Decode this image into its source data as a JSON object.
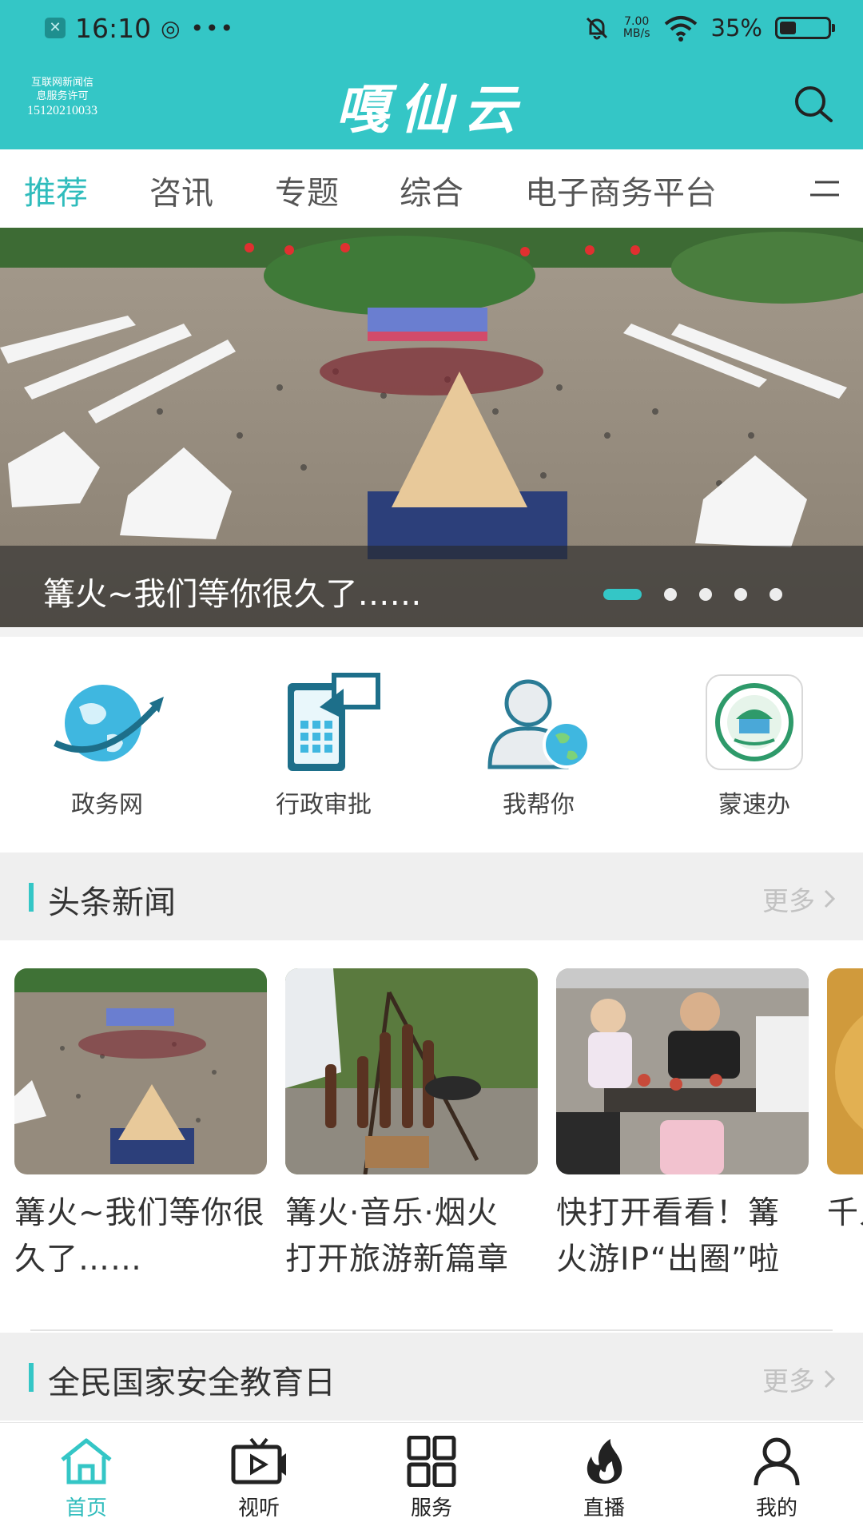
{
  "status_bar": {
    "time": "16:10",
    "misc": "◎ •••",
    "net_speed_value": "7.00",
    "net_speed_unit": "MB/s",
    "battery_text": "35%",
    "battery_level": 0.35
  },
  "header": {
    "license_line1": "互联网新闻信",
    "license_line2": "息服务许可",
    "license_number": "15120210033",
    "brand": "嘎仙云"
  },
  "tabs": [
    {
      "label": "推荐",
      "active": true
    },
    {
      "label": "咨讯",
      "active": false
    },
    {
      "label": "专题",
      "active": false
    },
    {
      "label": "综合",
      "active": false
    },
    {
      "label": "电子商务平台",
      "active": false
    }
  ],
  "hero": {
    "caption": "篝火~我们等你很久了……",
    "slide_count": 5,
    "active_slide": 1
  },
  "services": [
    {
      "label": "政务网",
      "icon": "globe-arrow-icon"
    },
    {
      "label": "行政审批",
      "icon": "approval-phone-icon"
    },
    {
      "label": "我帮你",
      "icon": "user-globe-icon"
    },
    {
      "label": "蒙速办",
      "icon": "mengsuban-logo-icon"
    }
  ],
  "sections": {
    "headline": {
      "title": "头条新闻",
      "more": "更多"
    },
    "security": {
      "title": "全民国家安全教育日",
      "more": "更多"
    }
  },
  "news": [
    {
      "title": "篝火~我们等你很久了……"
    },
    {
      "title": "篝火·音乐·烟火  打开旅游新篇章"
    },
    {
      "title": "快打开看看！篝火游IP“出圈”啦"
    },
    {
      "title": "千人篝火等你来"
    }
  ],
  "bottom_nav": [
    {
      "label": "首页",
      "icon": "home-icon",
      "active": true
    },
    {
      "label": "视听",
      "icon": "tv-play-icon",
      "active": false
    },
    {
      "label": "服务",
      "icon": "grid-icon",
      "active": false
    },
    {
      "label": "直播",
      "icon": "flame-icon",
      "active": false
    },
    {
      "label": "我的",
      "icon": "user-icon",
      "active": false
    }
  ],
  "colors": {
    "accent": "#34c6c6",
    "active_text": "#2fbcbc"
  }
}
